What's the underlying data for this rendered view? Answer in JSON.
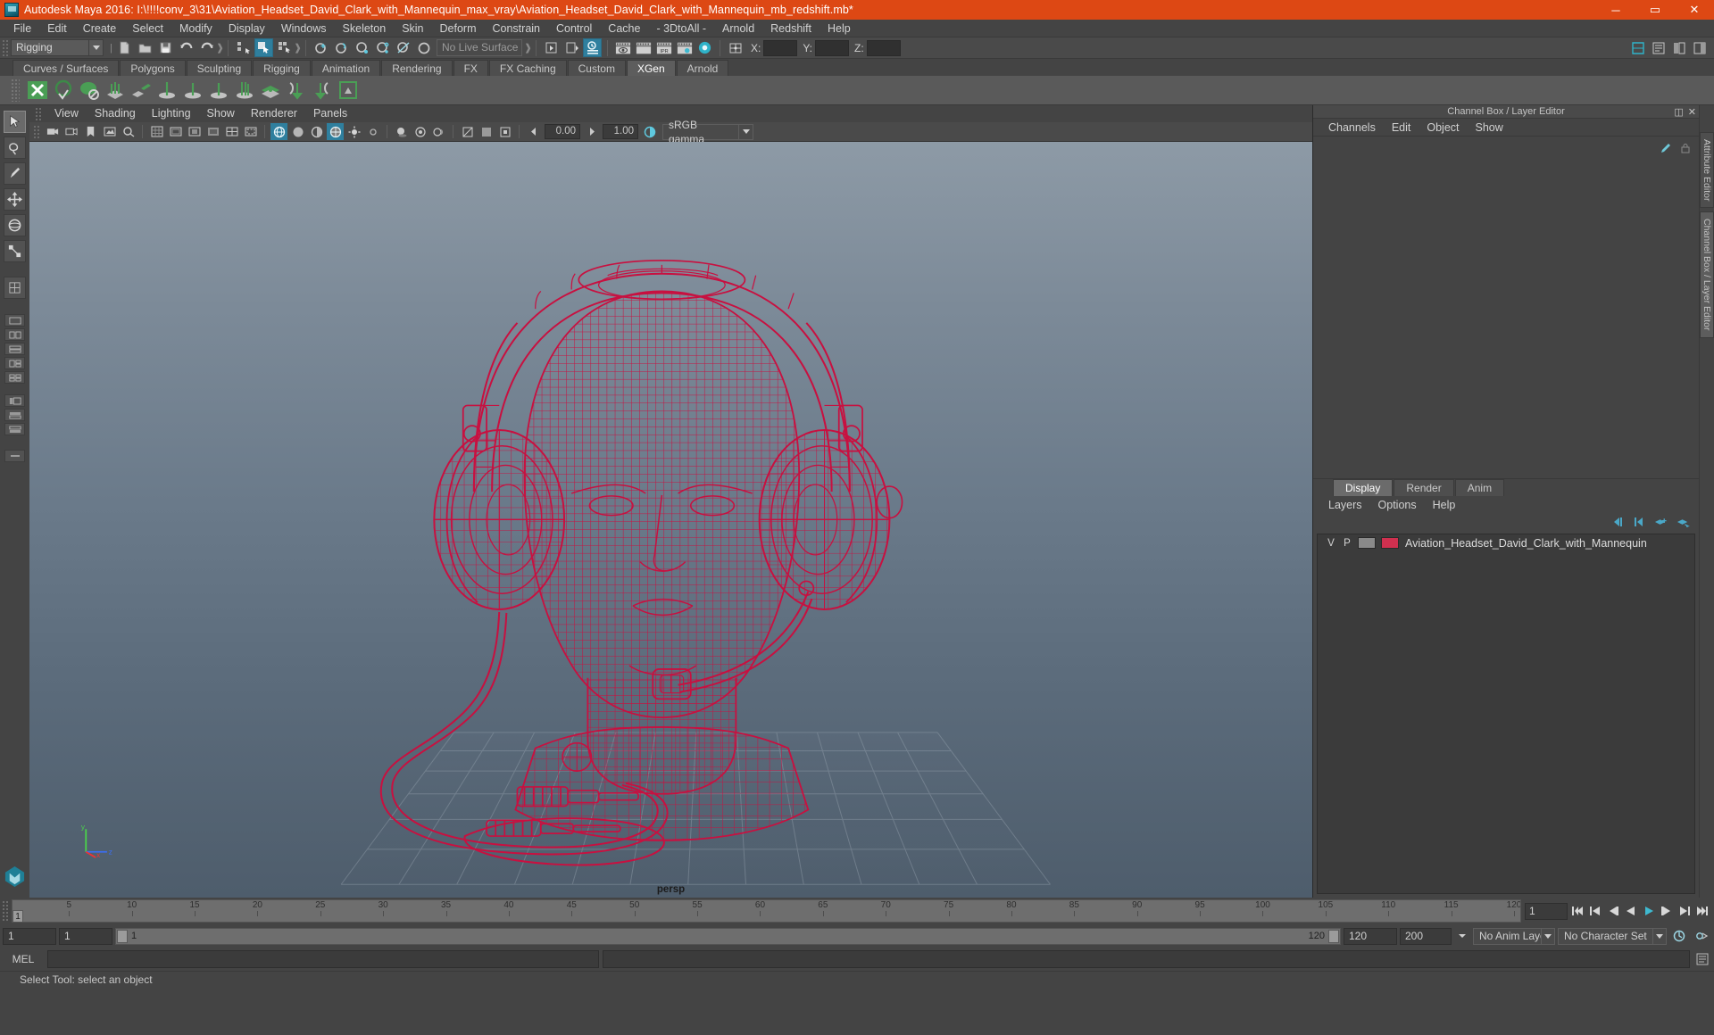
{
  "window": {
    "title": "Autodesk Maya 2016: I:\\!!!!conv_3\\31\\Aviation_Headset_David_Clark_with_Mannequin_max_vray\\Aviation_Headset_David_Clark_with_Mannequin_mb_redshift.mb*",
    "app_icon": "maya-app-icon",
    "minimize": "─",
    "maximize": "▭",
    "close": "✕",
    "titlebar_color": "#dd4814"
  },
  "menubar": {
    "items": [
      {
        "label": "File"
      },
      {
        "label": "Edit"
      },
      {
        "label": "Create"
      },
      {
        "label": "Select"
      },
      {
        "label": "Modify"
      },
      {
        "label": "Display"
      },
      {
        "label": "Windows"
      },
      {
        "label": "Skeleton"
      },
      {
        "label": "Skin"
      },
      {
        "label": "Deform"
      },
      {
        "label": "Constrain"
      },
      {
        "label": "Control"
      },
      {
        "label": "Cache"
      },
      {
        "label": "- 3DtoAll -"
      },
      {
        "label": "Arnold"
      },
      {
        "label": "Redshift"
      },
      {
        "label": "Help"
      }
    ]
  },
  "statusbar": {
    "menuset_value": "Rigging",
    "live_surface_text": "No Live Surface",
    "coord_x_label": "X:",
    "coord_y_label": "Y:",
    "coord_z_label": "Z:",
    "coord_x_value": "",
    "coord_y_value": "",
    "coord_z_value": "",
    "ipr_label": "IPR"
  },
  "shelf": {
    "tabs": [
      {
        "label": "Curves / Surfaces",
        "active": false
      },
      {
        "label": "Polygons",
        "active": false
      },
      {
        "label": "Sculpting",
        "active": false
      },
      {
        "label": "Rigging",
        "active": false
      },
      {
        "label": "Animation",
        "active": false
      },
      {
        "label": "Rendering",
        "active": false
      },
      {
        "label": "FX",
        "active": false
      },
      {
        "label": "FX Caching",
        "active": false
      },
      {
        "label": "Custom",
        "active": false
      },
      {
        "label": "XGen",
        "active": true
      },
      {
        "label": "Arnold",
        "active": false
      }
    ],
    "icon_names": [
      "xgen-logo-icon",
      "xgen-sphere-check-icon",
      "xgen-sphere-noentry-icon",
      "xgen-groom-icon",
      "xgen-patch-icon",
      "xgen-guide-add-icon",
      "xgen-guide-place-icon",
      "xgen-guide-lock-icon",
      "xgen-guide-comb-icon",
      "xgen-layers-icon",
      "xgen-import-icon",
      "xgen-export-icon",
      "xgen-render-icon"
    ],
    "accent_color": "#4a9e55"
  },
  "viewport_panel": {
    "menus": [
      {
        "label": "View"
      },
      {
        "label": "Shading"
      },
      {
        "label": "Lighting"
      },
      {
        "label": "Show"
      },
      {
        "label": "Renderer"
      },
      {
        "label": "Panels"
      }
    ],
    "exposure_value": "0.00",
    "gamma_value": "1.00",
    "color_profile": "sRGB gamma",
    "camera_label": "persp",
    "background_top": "#8d9aa6",
    "background_bottom": "#4e5d6c",
    "wireframe_color": "#c81040",
    "axis_labels": {
      "x": "x",
      "y": "y",
      "z": "z"
    }
  },
  "channel_box": {
    "panel_title": "Channel Box / Layer Editor",
    "menus": [
      {
        "label": "Channels"
      },
      {
        "label": "Edit"
      },
      {
        "label": "Object"
      },
      {
        "label": "Show"
      }
    ],
    "dock_float_icon": "undock-icon",
    "dock_close_icon": "close-icon"
  },
  "layer_editor": {
    "tabs": [
      {
        "label": "Display",
        "active": true
      },
      {
        "label": "Render",
        "active": false
      },
      {
        "label": "Anim",
        "active": false
      }
    ],
    "menus": [
      {
        "label": "Layers"
      },
      {
        "label": "Options"
      },
      {
        "label": "Help"
      }
    ],
    "columns": {
      "visible": "V",
      "playback": "P"
    },
    "layers": [
      {
        "visible": "V",
        "playback": "P",
        "swatch_color": "#8a8a8a",
        "color": "#d0304f",
        "name": "Aviation_Headset_David_Clark_with_Mannequin"
      }
    ]
  },
  "right_tabs": [
    {
      "label": "Attribute Editor",
      "active": false
    },
    {
      "label": "Channel Box / Layer Editor",
      "active": true
    }
  ],
  "timeline": {
    "start_visible": "1",
    "ticks": [
      {
        "value": "5"
      },
      {
        "value": "10"
      },
      {
        "value": "15"
      },
      {
        "value": "20"
      },
      {
        "value": "25"
      },
      {
        "value": "30"
      },
      {
        "value": "35"
      },
      {
        "value": "40"
      },
      {
        "value": "45"
      },
      {
        "value": "50"
      },
      {
        "value": "55"
      },
      {
        "value": "60"
      },
      {
        "value": "65"
      },
      {
        "value": "70"
      },
      {
        "value": "75"
      },
      {
        "value": "80"
      },
      {
        "value": "85"
      },
      {
        "value": "90"
      },
      {
        "value": "95"
      },
      {
        "value": "100"
      },
      {
        "value": "105"
      },
      {
        "value": "110"
      },
      {
        "value": "115"
      },
      {
        "value": "120"
      }
    ],
    "current_frame": "1",
    "current_frame_field": "1",
    "playback_icons": [
      "go-to-start-icon",
      "step-back-key-icon",
      "step-back-frame-icon",
      "play-backwards-icon",
      "play-forwards-icon",
      "step-forward-frame-icon",
      "step-forward-key-icon",
      "go-to-end-icon"
    ]
  },
  "range_slider": {
    "anim_start": "1",
    "range_start": "1",
    "bar_start_label": "1",
    "bar_end_label": "120",
    "range_end": "120",
    "anim_end": "200",
    "anim_layer_value": "No Anim Layer",
    "character_set_value": "No Character Set",
    "auto_key_icon": "auto-keyframe-icon",
    "prefs_icon": "animation-preferences-icon"
  },
  "command_line": {
    "mode_label": "MEL",
    "input_value": "",
    "output_value": "",
    "script_editor_icon": "script-editor-icon"
  },
  "help_line": {
    "text": "Select Tool: select an object"
  }
}
